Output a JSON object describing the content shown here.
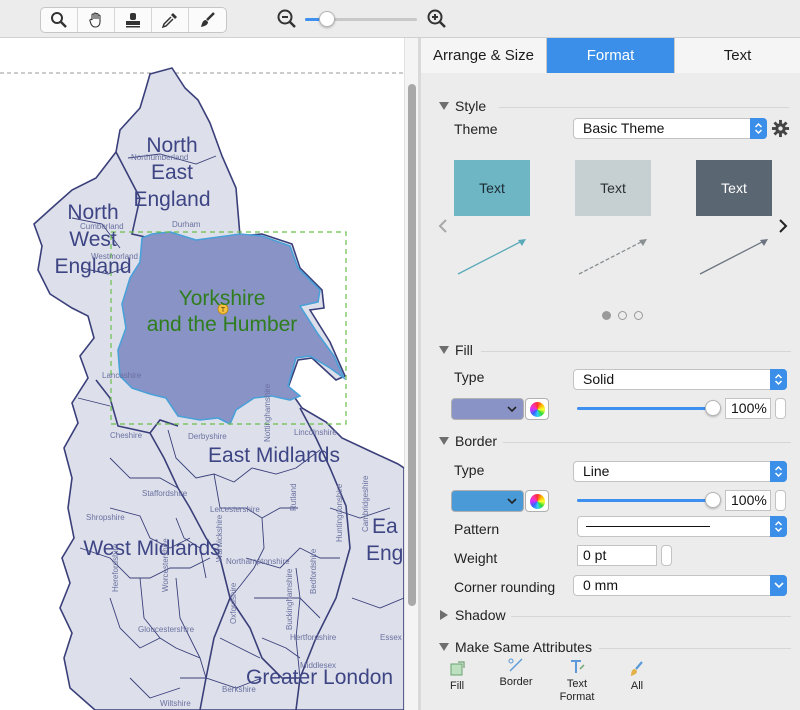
{
  "toolbar": {
    "tools": [
      "search-icon",
      "hand-icon",
      "stamp-icon",
      "eyedropper-icon",
      "brush-icon"
    ],
    "zoom_level": 0.2
  },
  "map": {
    "selected_region": "Yorkshire and the Humber",
    "selected_region_lines": [
      "Yorkshire",
      "and the Humber"
    ],
    "region_labels": {
      "north_east": [
        "North",
        "East",
        "England"
      ],
      "north_west": [
        "North",
        "West",
        "England"
      ],
      "east_midlands": "East Midlands",
      "west_midlands": "West Midlands",
      "east_england": [
        "Ea",
        "Eng"
      ],
      "greater_london": "Greater London"
    },
    "county_labels": [
      "Northumberland",
      "Cumberland",
      "Durham",
      "Westmorland",
      "Lancashire",
      "Cheshire",
      "Derbyshire",
      "Nottinghamshire",
      "Lincolnshire",
      "Staffordshire",
      "Leicestershire",
      "Rutland",
      "Shropshire",
      "Northamptonshire",
      "Herefordshire",
      "Worcestershire",
      "Warwickshire",
      "Oxfordshire",
      "Buckinghamshire",
      "Bedfordshire",
      "Huntingdonshire",
      "Cambridgeshire",
      "Gloucestershire",
      "Hertfordshire",
      "Middlesex",
      "Berkshire",
      "Wiltshire",
      "Essex"
    ],
    "colors": {
      "land": "#dde0ea",
      "border": "#3a3f7a",
      "selected": "#8a93c6",
      "label": "#3e4585",
      "selected_text": "#2f7d1f"
    }
  },
  "panel": {
    "tabs": [
      {
        "label": "Arrange & Size",
        "active": false
      },
      {
        "label": "Format",
        "active": true
      },
      {
        "label": "Text",
        "active": false
      }
    ],
    "style": {
      "heading": "Style",
      "theme_label": "Theme",
      "theme_value": "Basic Theme",
      "gear": "gear-icon",
      "theme_samples": [
        {
          "text": "Text",
          "bg": "#6fb6c4",
          "fg": "#1b2a33",
          "line": "#5aaab8",
          "dashed": false
        },
        {
          "text": "Text",
          "bg": "#c6d0d2",
          "fg": "#2a2f33",
          "line": "#8a8f92",
          "dashed": true
        },
        {
          "text": "Text",
          "bg": "#5a6672",
          "fg": "#ffffff",
          "line": "#6b7480",
          "dashed": false
        }
      ],
      "pager": {
        "count": 3,
        "current": 1
      }
    },
    "fill": {
      "heading": "Fill",
      "type_label": "Type",
      "type_value": "Solid",
      "color": "#8a93c6",
      "opacity": "100%"
    },
    "border": {
      "heading": "Border",
      "type_label": "Type",
      "type_value": "Line",
      "color": "#4a9ad8",
      "opacity": "100%",
      "pattern_label": "Pattern",
      "weight_label": "Weight",
      "weight_value": "0 pt",
      "corner_label": "Corner rounding",
      "corner_value": "0 mm"
    },
    "shadow": {
      "heading": "Shadow"
    },
    "same_attrs": {
      "heading": "Make Same Attributes",
      "buttons": [
        "Fill",
        "Border",
        "Text Format",
        "All"
      ]
    }
  }
}
